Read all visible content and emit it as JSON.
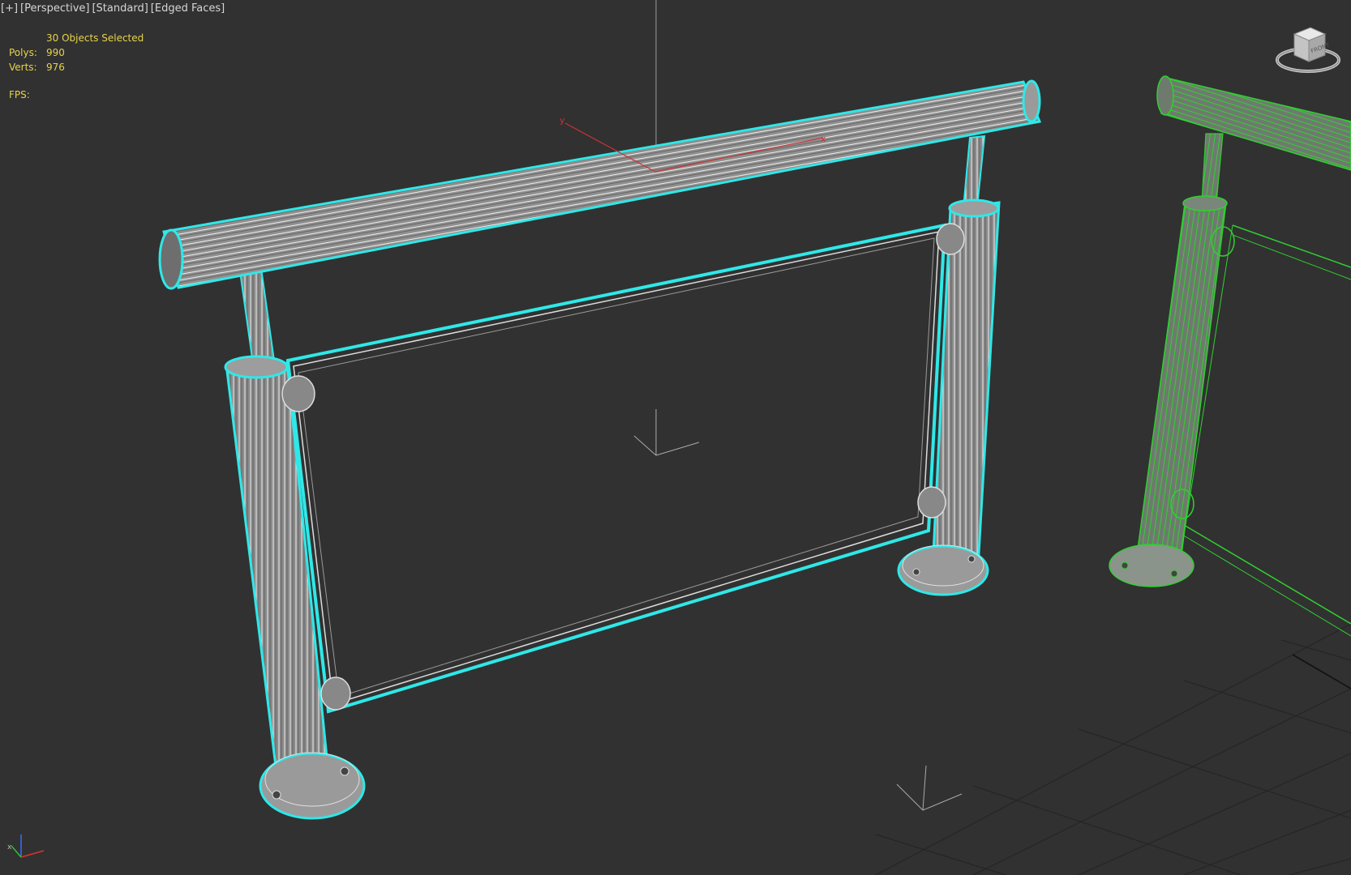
{
  "viewport": {
    "menu": {
      "plus": "[+]",
      "view": "[Perspective]",
      "shading_standard": "[Standard]",
      "shading_mode": "[Edged Faces]"
    },
    "stats": {
      "selection": "30 Objects Selected",
      "polys_label": "Polys:",
      "polys_value": "990",
      "verts_label": "Verts:",
      "verts_value": "976",
      "fps_label": "FPS:"
    },
    "viewcube": {
      "face_label": "FRONT"
    },
    "colors": {
      "background": "#313131",
      "selection_outline": "#2fe8e8",
      "geometry_fill": "#8c8c8c",
      "secondary_wire": "#2fd12f",
      "stats_text": "#e6d34a",
      "gizmo_x": "#cc3333"
    },
    "icons": [
      "viewcube-icon",
      "axis-tripod-icon",
      "transform-gizmo-icon"
    ]
  }
}
